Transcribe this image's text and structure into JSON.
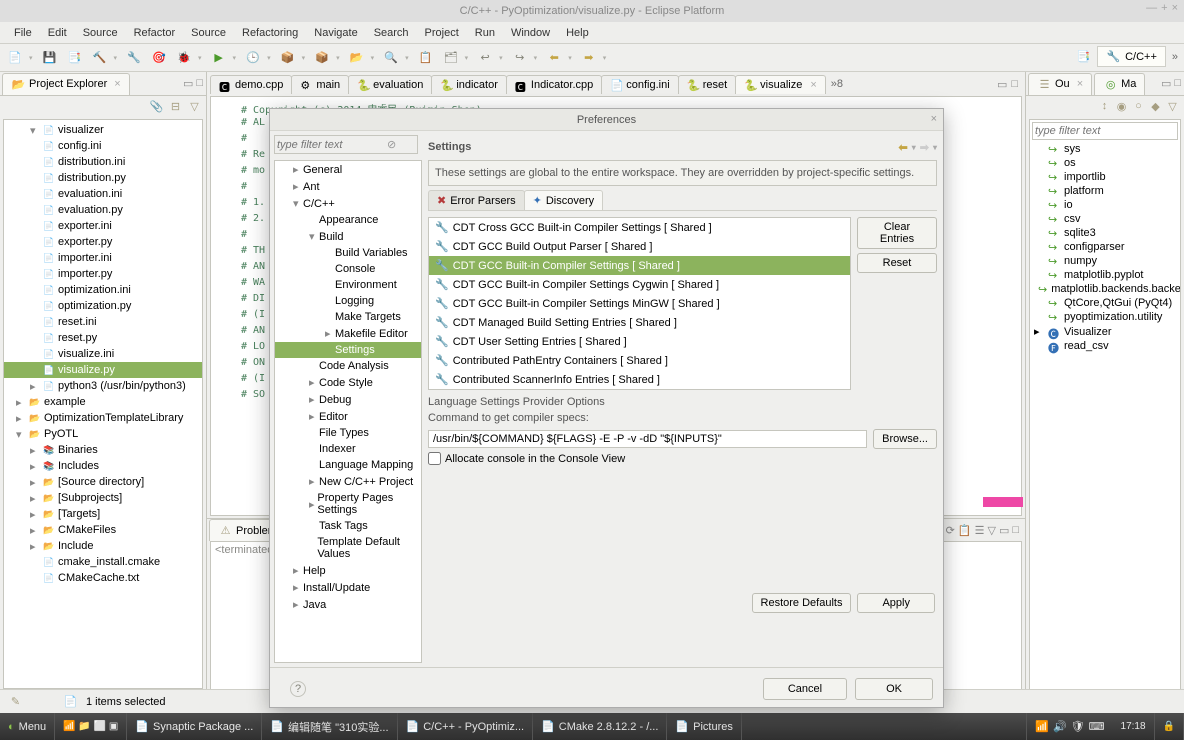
{
  "window_title": "C/C++ - PyOptimization/visualize.py - Eclipse Platform",
  "menu": [
    "File",
    "Edit",
    "Source",
    "Refactor",
    "Source",
    "Refactoring",
    "Navigate",
    "Search",
    "Project",
    "Run",
    "Window",
    "Help"
  ],
  "perspective": "C/C++",
  "left": {
    "title": "Project Explorer",
    "items": [
      {
        "t": "visualizer",
        "k": "py",
        "lvl": 2,
        "exp": true
      },
      {
        "t": "config.ini",
        "k": "cfg",
        "lvl": 2
      },
      {
        "t": "distribution.ini",
        "k": "cfg",
        "lvl": 2
      },
      {
        "t": "distribution.py",
        "k": "py",
        "lvl": 2
      },
      {
        "t": "evaluation.ini",
        "k": "cfg",
        "lvl": 2
      },
      {
        "t": "evaluation.py",
        "k": "py",
        "lvl": 2
      },
      {
        "t": "exporter.ini",
        "k": "cfg",
        "lvl": 2
      },
      {
        "t": "exporter.py",
        "k": "py",
        "lvl": 2
      },
      {
        "t": "importer.ini",
        "k": "cfg",
        "lvl": 2
      },
      {
        "t": "importer.py",
        "k": "py",
        "lvl": 2
      },
      {
        "t": "optimization.ini",
        "k": "cfg",
        "lvl": 2
      },
      {
        "t": "optimization.py",
        "k": "py",
        "lvl": 2
      },
      {
        "t": "reset.ini",
        "k": "cfg",
        "lvl": 2
      },
      {
        "t": "reset.py",
        "k": "py",
        "lvl": 2
      },
      {
        "t": "visualize.ini",
        "k": "cfg",
        "lvl": 2
      },
      {
        "t": "visualize.py",
        "k": "py",
        "lvl": 2,
        "sel": true
      },
      {
        "t": "python3 (/usr/bin/python3)",
        "k": "py",
        "lvl": 2,
        "exp": false
      },
      {
        "t": "example",
        "k": "folder",
        "lvl": 1,
        "exp": false
      },
      {
        "t": "OptimizationTemplateLibrary",
        "k": "folder",
        "lvl": 1,
        "exp": false
      },
      {
        "t": "PyOTL",
        "k": "folder",
        "lvl": 1,
        "exp": true
      },
      {
        "t": "Binaries",
        "k": "lib",
        "lvl": 2,
        "exp": false
      },
      {
        "t": "Includes",
        "k": "lib",
        "lvl": 2,
        "exp": false
      },
      {
        "t": "[Source directory]",
        "k": "folder",
        "lvl": 2,
        "exp": false
      },
      {
        "t": "[Subprojects]",
        "k": "folder",
        "lvl": 2,
        "exp": false
      },
      {
        "t": "[Targets]",
        "k": "folder",
        "lvl": 2,
        "exp": false
      },
      {
        "t": "CMakeFiles",
        "k": "folder",
        "lvl": 2,
        "exp": false
      },
      {
        "t": "Include",
        "k": "folder",
        "lvl": 2,
        "exp": false
      },
      {
        "t": "cmake_install.cmake",
        "k": "cfg",
        "lvl": 2
      },
      {
        "t": "CMakeCache.txt",
        "k": "cfg",
        "lvl": 2
      }
    ]
  },
  "editor_tabs": [
    {
      "label": "demo.cpp",
      "k": "c"
    },
    {
      "label": "main",
      "k": "b"
    },
    {
      "label": "evaluation",
      "k": "p"
    },
    {
      "label": "indicator",
      "k": "p"
    },
    {
      "label": "Indicator.cpp",
      "k": "c"
    },
    {
      "label": "config.ini",
      "k": "cfg"
    },
    {
      "label": "reset",
      "k": "p"
    },
    {
      "label": "visualize",
      "k": "p",
      "active": true
    }
  ],
  "editor_overflow": "»8",
  "code_lines": [
    "# Copyright (c) 2014 申睿民 (Ruimin Shen)",
    "# AL",
    "#",
    "# Re",
    "# mo",
    "#",
    "# 1.",
    "# 2.",
    "#",
    "# TH",
    "# AN",
    "# WA",
    "# DI",
    "# (I",
    "# AN",
    "# LO",
    "# ON",
    "# (I",
    "# SO"
  ],
  "bottom": {
    "tab": "Problems",
    "body_prefix": "<terminated"
  },
  "outline": {
    "tabs": [
      "Ou",
      "Ma"
    ],
    "filter_placeholder": "type filter text",
    "items": [
      {
        "t": "sys",
        "k": "m"
      },
      {
        "t": "os",
        "k": "m"
      },
      {
        "t": "importlib",
        "k": "m"
      },
      {
        "t": "platform",
        "k": "m"
      },
      {
        "t": "io",
        "k": "m"
      },
      {
        "t": "csv",
        "k": "m"
      },
      {
        "t": "sqlite3",
        "k": "m"
      },
      {
        "t": "configparser",
        "k": "m"
      },
      {
        "t": "numpy",
        "k": "m"
      },
      {
        "t": "matplotlib.pyplot",
        "k": "m"
      },
      {
        "t": "matplotlib.backends.backend",
        "k": "m"
      },
      {
        "t": "QtCore,QtGui (PyQt4)",
        "k": "m"
      },
      {
        "t": "pyoptimization.utility",
        "k": "m"
      },
      {
        "t": "Visualizer",
        "k": "c",
        "exp": false
      },
      {
        "t": "read_csv",
        "k": "f"
      }
    ]
  },
  "status": {
    "left_icon": "writable-icon",
    "selection": "1 items selected"
  },
  "dialog": {
    "title": "Preferences",
    "filter_placeholder": "type filter text",
    "tree": [
      {
        "t": "General",
        "caret": "▸",
        "lvl": 0
      },
      {
        "t": "Ant",
        "caret": "▸",
        "lvl": 0
      },
      {
        "t": "C/C++",
        "caret": "▾",
        "lvl": 0
      },
      {
        "t": "Appearance",
        "lvl": 1
      },
      {
        "t": "Build",
        "caret": "▾",
        "lvl": 1
      },
      {
        "t": "Build Variables",
        "lvl": 2
      },
      {
        "t": "Console",
        "lvl": 2
      },
      {
        "t": "Environment",
        "lvl": 2
      },
      {
        "t": "Logging",
        "lvl": 2
      },
      {
        "t": "Make Targets",
        "lvl": 2
      },
      {
        "t": "Makefile Editor",
        "caret": "▸",
        "lvl": 2
      },
      {
        "t": "Settings",
        "lvl": 2,
        "sel": true
      },
      {
        "t": "Code Analysis",
        "lvl": 1
      },
      {
        "t": "Code Style",
        "caret": "▸",
        "lvl": 1
      },
      {
        "t": "Debug",
        "caret": "▸",
        "lvl": 1
      },
      {
        "t": "Editor",
        "caret": "▸",
        "lvl": 1
      },
      {
        "t": "File Types",
        "lvl": 1
      },
      {
        "t": "Indexer",
        "lvl": 1
      },
      {
        "t": "Language Mapping",
        "lvl": 1
      },
      {
        "t": "New C/C++ Project",
        "caret": "▸",
        "lvl": 1
      },
      {
        "t": "Property Pages Settings",
        "caret": "▸",
        "lvl": 1
      },
      {
        "t": "Task Tags",
        "lvl": 1
      },
      {
        "t": "Template Default Values",
        "lvl": 1
      },
      {
        "t": "Help",
        "caret": "▸",
        "lvl": 0
      },
      {
        "t": "Install/Update",
        "caret": "▸",
        "lvl": 0
      },
      {
        "t": "Java",
        "caret": "▸",
        "lvl": 0
      }
    ],
    "heading": "Settings",
    "banner": "These settings are global to the entire workspace.  They are overridden by project-specific settings.",
    "tabs": {
      "error": "Error Parsers",
      "discovery": "Discovery"
    },
    "providers": [
      "CDT Cross GCC Built-in Compiler Settings   [ Shared ]",
      "CDT GCC Build Output Parser   [ Shared ]",
      "CDT GCC Built-in Compiler Settings   [ Shared ]",
      "CDT GCC Built-in Compiler Settings Cygwin   [ Shared ]",
      "CDT GCC Built-in Compiler Settings MinGW   [ Shared ]",
      "CDT Managed Build Setting Entries   [ Shared ]",
      "CDT User Setting Entries   [ Shared ]",
      "Contributed PathEntry Containers   [ Shared ]",
      "Contributed ScannerInfo Entries   [ Shared ]"
    ],
    "selected_provider_index": 2,
    "side_buttons": {
      "clear": "Clear Entries",
      "reset": "Reset"
    },
    "opts": {
      "heading": "Language Settings Provider Options",
      "cmd_label": "Command to get compiler specs:",
      "cmd_value": "/usr/bin/${COMMAND} ${FLAGS} -E -P -v -dD \"${INPUTS}\"",
      "browse": "Browse...",
      "allocate": "Allocate console in the Console View"
    },
    "footer": {
      "restore": "Restore Defaults",
      "apply": "Apply",
      "cancel": "Cancel",
      "ok": "OK"
    }
  },
  "os_taskbar": {
    "menu": "Menu",
    "items": [
      "Synaptic Package ...",
      "编辑随笔 \"310实验...",
      "C/C++ - PyOptimiz...",
      "CMake 2.8.12.2 - /...",
      "Pictures"
    ],
    "clock": "17:18"
  }
}
